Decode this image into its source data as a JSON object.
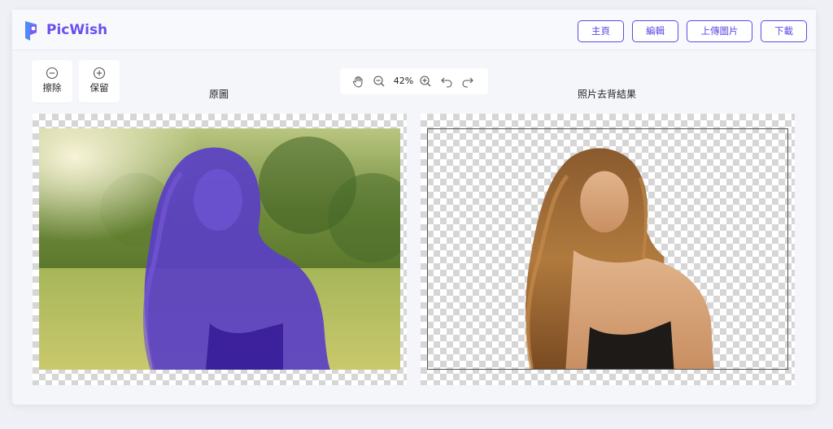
{
  "app": {
    "brand": "PicWish",
    "brand_color": "#6b4ff0",
    "accent_color": "#5b4ae8"
  },
  "nav": {
    "home": "主頁",
    "edit": "編輯",
    "upload": "上傳圖片",
    "download": "下載"
  },
  "tools": {
    "erase": "擦除",
    "keep": "保留"
  },
  "zoom": {
    "value": "42%"
  },
  "panels": {
    "original_title": "原圖",
    "result_title": "照片去背結果"
  },
  "icons": [
    "picwish-logo-icon",
    "minus-circle-icon",
    "plus-circle-icon",
    "hand-pan-icon",
    "zoom-out-icon",
    "zoom-in-icon",
    "undo-icon",
    "redo-icon"
  ]
}
